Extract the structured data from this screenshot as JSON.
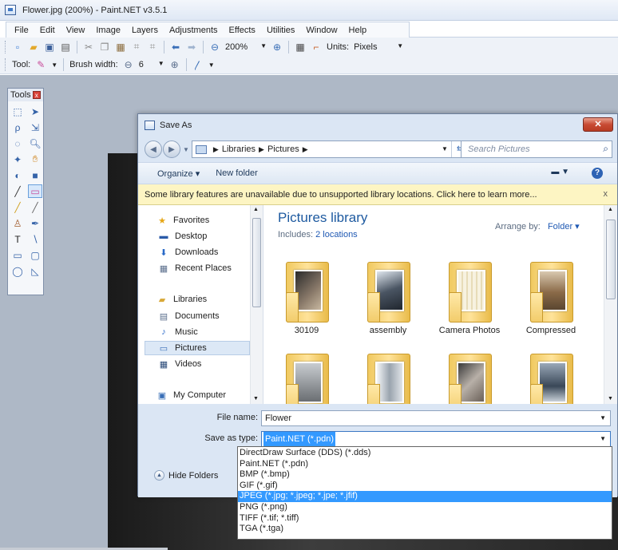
{
  "app": {
    "title": "Flower.jpg (200%) - Paint.NET v3.5.1",
    "menu": [
      "File",
      "Edit",
      "View",
      "Image",
      "Layers",
      "Adjustments",
      "Effects",
      "Utilities",
      "Window",
      "Help"
    ]
  },
  "toolbar": {
    "zoom_value": "200%",
    "units_label": "Units:",
    "units_value": "Pixels",
    "tool_label": "Tool:",
    "brush_width_label": "Brush width:",
    "brush_width_value": "6"
  },
  "tools_palette": {
    "title": "Tools"
  },
  "dialog": {
    "title": "Save As",
    "breadcrumb": [
      "Libraries",
      "Pictures"
    ],
    "search_placeholder": "Search Pictures",
    "commands": {
      "organize": "Organize ▾",
      "new_folder": "New folder"
    },
    "infobar_text": "Some library features are unavailable due to unsupported library locations. Click here to learn more...",
    "infobar_close": "x",
    "nav": {
      "favorites": "Favorites",
      "desktop": "Desktop",
      "downloads": "Downloads",
      "recent_places": "Recent Places",
      "libraries": "Libraries",
      "documents": "Documents",
      "music": "Music",
      "pictures": "Pictures",
      "videos": "Videos",
      "my_computer": "My Computer"
    },
    "library": {
      "title": "Pictures library",
      "includes_label": "Includes:",
      "includes_link": "2 locations",
      "arrange_label": "Arrange by:",
      "arrange_value": "Folder ▾"
    },
    "folders": [
      {
        "name": "30109"
      },
      {
        "name": "assembly"
      },
      {
        "name": "Camera Photos"
      },
      {
        "name": "Compressed"
      }
    ],
    "file_name_label": "File name:",
    "file_name_value": "Flower",
    "save_type_label": "Save as type:",
    "save_type_value": "Paint.NET (*.pdn)",
    "hide_folders": "Hide Folders",
    "type_options": [
      "DirectDraw Surface (DDS) (*.dds)",
      "Paint.NET (*.pdn)",
      "BMP (*.bmp)",
      "GIF (*.gif)",
      "JPEG (*.jpg; *.jpeg; *.jpe; *.jfif)",
      "PNG (*.png)",
      "TIFF (*.tif; *.tiff)",
      "TGA (*.tga)"
    ],
    "highlighted_option": "JPEG (*.jpg; *.jpeg; *.jpe; *.jfif)"
  },
  "colors": {
    "accent": "#3399ff",
    "infobar": "#fdf5c3",
    "library_title": "#1e5aa0",
    "close_button": "#c84b34"
  }
}
